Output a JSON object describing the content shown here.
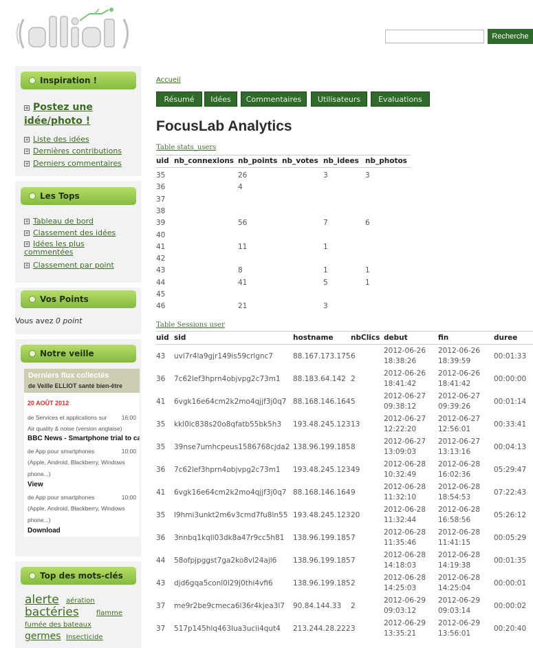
{
  "header": {
    "logo_text": "elliot",
    "search_placeholder": "",
    "search_button": "Recherche"
  },
  "sidebar": {
    "inspiration": {
      "title": "Inspiration !",
      "cta": "Postez une idée/photo !",
      "links": [
        "Liste des idées",
        "Dernières contributions",
        "Derniers commentaires"
      ]
    },
    "tops": {
      "title": "Les Tops",
      "links": [
        "Tableau de bord",
        "Classement des idées",
        "Idées les plus commentées",
        "Classement par point"
      ]
    },
    "points": {
      "title": "Vos Points",
      "text_prefix": "Vous avez ",
      "points_value": "0 point"
    },
    "veille": {
      "title": "Notre veille",
      "flux_title": "Derniers flux collectés",
      "flux_sub": "de Veille ELLIOT santé bien-être",
      "date": "20 AOÛT 2012",
      "items": [
        {
          "text": "de Services et applications sur",
          "time": "16:00"
        },
        {
          "text": "Air quality & noise (version anglaise)",
          "time": ""
        },
        {
          "text": "BBC News - Smartphone trial to ca",
          "time": "",
          "bold": true
        },
        {
          "text": "de App pour smartphones",
          "time": "10:00"
        },
        {
          "text": "(Apple, Android, Blackberry, Windows",
          "time": ""
        },
        {
          "text": "phone...)",
          "time": ""
        },
        {
          "text": "View",
          "time": "",
          "bold": true
        },
        {
          "text": "de App pour smartphones",
          "time": "10:00"
        },
        {
          "text": "(Apple, Android, Blackberry, Windows",
          "time": ""
        },
        {
          "text": "phone...)",
          "time": ""
        },
        {
          "text": "Download",
          "time": "",
          "bold": true
        }
      ]
    },
    "keywords": {
      "title": "Top des mots-clés",
      "tags": [
        "alerte",
        "aération",
        "bactéries",
        "flamme",
        "fumée des bateaux",
        "germes",
        "Insecticide"
      ]
    }
  },
  "main": {
    "breadcrumb": "Accueil",
    "tabs": [
      "Résumé",
      "Idées",
      "Commentaires",
      "Utilisateurs",
      "Evaluations"
    ],
    "title": "FocusLab Analytics",
    "stats_caption": "Table stats_users",
    "stats_columns": [
      "uid",
      "nb_connexions",
      "nb_points",
      "nb_votes",
      "nb_idees",
      "nb_photos"
    ],
    "stats_rows": [
      [
        "35",
        "",
        "26",
        "",
        "3",
        "3"
      ],
      [
        "36",
        "",
        "4",
        "",
        "",
        ""
      ],
      [
        "37",
        "",
        "",
        "",
        "",
        ""
      ],
      [
        "38",
        "",
        "",
        "",
        "",
        ""
      ],
      [
        "39",
        "",
        "56",
        "",
        "7",
        "6"
      ],
      [
        "40",
        "",
        "",
        "",
        "",
        ""
      ],
      [
        "41",
        "",
        "11",
        "",
        "1",
        ""
      ],
      [
        "42",
        "",
        "",
        "",
        "",
        ""
      ],
      [
        "43",
        "",
        "8",
        "",
        "1",
        "1"
      ],
      [
        "44",
        "",
        "41",
        "",
        "5",
        "1"
      ],
      [
        "45",
        "",
        "",
        "",
        "",
        ""
      ],
      [
        "46",
        "",
        "21",
        "",
        "3",
        ""
      ]
    ],
    "sessions_caption": "Table Sessions user",
    "sessions_columns": [
      "uid",
      "sid",
      "hostname",
      "nbClics",
      "debut",
      "fin",
      "duree"
    ],
    "sessions_rows": [
      [
        "43",
        "uvi7r4la9gjr149is59crlgnc7",
        "88.167.173.175",
        "6",
        "2012-06-26 18:38:26",
        "2012-06-26 18:39:59",
        "00:01:33"
      ],
      [
        "36",
        "7c62lef3hprn4objvpg2c73m1",
        "88.183.64.142",
        "2",
        "2012-06-26 18:41:42",
        "2012-06-26 18:41:42",
        "00:00:00"
      ],
      [
        "41",
        "6vgk16e64cm2k2mo4qjjf3j0q7",
        "88.168.146.164",
        "5",
        "2012-06-27 09:38:12",
        "2012-06-27 09:39:26",
        "00:01:14"
      ],
      [
        "35",
        "kkl0ic838s20o8qfatb55bk5h3",
        "193.48.245.123",
        "13",
        "2012-06-27 12:22:20",
        "2012-06-27 12:56:01",
        "00:33:41"
      ],
      [
        "35",
        "39nse7umhcpeus1586768cjda2",
        "138.96.199.185",
        "8",
        "2012-06-27 13:09:03",
        "2012-06-27 13:13:16",
        "00:04:13"
      ],
      [
        "36",
        "7c62lef3hprn4objvpg2c73m1",
        "193.48.245.123",
        "49",
        "2012-06-28 10:32:49",
        "2012-06-28 16:02:36",
        "05:29:47"
      ],
      [
        "41",
        "6vgk16e64cm2k2mo4qjjf3j0q7",
        "88.168.146.164",
        "9",
        "2012-06-28 11:32:10",
        "2012-06-28 18:54:53",
        "07:22:43"
      ],
      [
        "35",
        "l9hmi3unkt2m6v3cmd7fu8ln55",
        "193.48.245.123",
        "20",
        "2012-06-28 11:32:44",
        "2012-06-28 16:58:56",
        "05:26:12"
      ],
      [
        "36",
        "3nnbq1kqll03dk8a47r9cc5h81",
        "138.96.199.185",
        "7",
        "2012-06-28 11:35:46",
        "2012-06-28 11:41:15",
        "00:05:29"
      ],
      [
        "44",
        "58ofpjpggst7ga2ko8vl24ajl6",
        "138.96.199.185",
        "7",
        "2012-06-28 14:18:03",
        "2012-06-28 14:19:38",
        "00:01:35"
      ],
      [
        "43",
        "djd6gqa5conl0l29j0thi4vfi6",
        "138.96.199.185",
        "2",
        "2012-06-28 14:25:03",
        "2012-06-28 14:25:04",
        "00:00:01"
      ],
      [
        "37",
        "me9r2be9cmeca6l36r4kjea3l7",
        "90.84.144.33",
        "2",
        "2012-06-29 09:03:12",
        "2012-06-29 09:03:14",
        "00:00:02"
      ],
      [
        "37",
        "517p145hlq463lua3ucii4qut4",
        "213.244.28.222",
        "3",
        "2012-06-29 13:35:21",
        "2012-06-29 13:56:01",
        "00:20:40"
      ]
    ]
  }
}
